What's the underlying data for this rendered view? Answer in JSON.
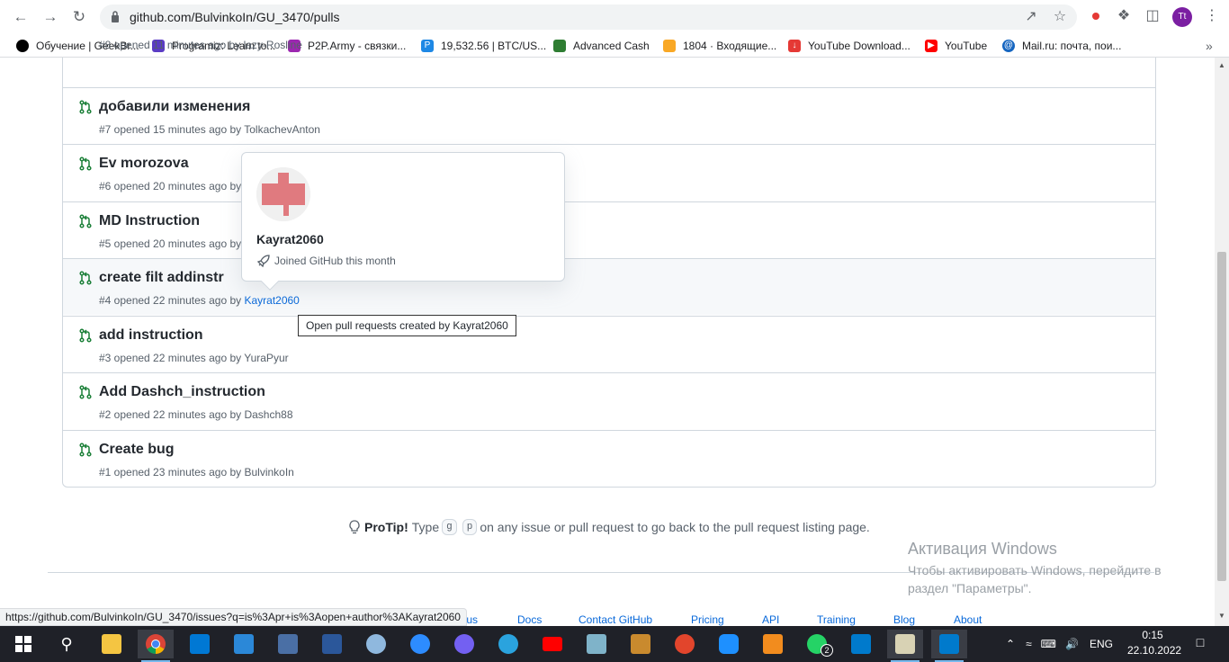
{
  "browser": {
    "url": "github.com/BulvinkoIn/GU_3470/pulls",
    "profile_initials": "Tt",
    "bookmarks": [
      {
        "label": "Обучение | GeekBr...",
        "color": "#000000"
      },
      {
        "label": "Programiz: Learn to...",
        "color": "#5b3cc4"
      },
      {
        "label": "P2P.Army - связки...",
        "color": "#9c27b0"
      },
      {
        "label": "19,532.56 | BTC/US...",
        "color": "#1e88e5"
      },
      {
        "label": "Advanced Cash",
        "color": "#2e7d32"
      },
      {
        "label": "1804 · Входящие...",
        "color": "#f9a825"
      },
      {
        "label": "YouTube Download...",
        "color": "#e53935"
      },
      {
        "label": "YouTube",
        "color": "#ff0000"
      },
      {
        "label": "Mail.ru: почта, пои...",
        "color": "#1565c0"
      }
    ]
  },
  "pulls": [
    {
      "title": "",
      "meta": "#8 opened 11 minutes ago by ",
      "author": "lazy-Rosline"
    },
    {
      "title": "добавили изменения",
      "meta": "#7 opened 15 minutes ago by ",
      "author": "TolkachevAnton"
    },
    {
      "title": "Ev morozova",
      "meta": "#6 opened 20 minutes ago by ",
      "author": ""
    },
    {
      "title": "MD Instruction",
      "meta": "#5 opened 20 minutes ago by ",
      "author": ""
    },
    {
      "title": "create filt addinstr",
      "meta": "#4 opened 22 minutes ago by ",
      "author": "Kayrat2060"
    },
    {
      "title": "add instruction",
      "meta": "#3 opened 22 minutes ago by ",
      "author": "YuraPyur"
    },
    {
      "title": "Add Dashch_instruction",
      "meta": "#2 opened 22 minutes ago by ",
      "author": "Dashch88"
    },
    {
      "title": "Create bug",
      "meta": "#1 opened 23 minutes ago by ",
      "author": "BulvinkoIn"
    }
  ],
  "hovercard": {
    "name": "Kayrat2060",
    "joined": "Joined GitHub this month"
  },
  "tooltip": "Open pull requests created by Kayrat2060",
  "protip": {
    "bold": "ProTip!",
    "before": "Type",
    "key1": "g",
    "key2": "p",
    "after": "on any issue or pull request to go back to the pull request listing page."
  },
  "footer": {
    "links": [
      "tus",
      "Docs",
      "Contact GitHub",
      "Pricing",
      "API",
      "Training",
      "Blog",
      "About"
    ]
  },
  "activation": {
    "title": "Активация Windows",
    "text": "Чтобы активировать Windows, перейдите в раздел \"Параметры\"."
  },
  "status_url": "https://github.com/BulvinkoIn/GU_3470/issues?q=is%3Apr+is%3Aopen+author%3AKayrat2060",
  "taskbar": {
    "lang": "ENG",
    "time": "0:15",
    "date": "22.10.2022",
    "whatsapp_badge": "2"
  },
  "colors": {
    "pr_open_green": "#1a7f37",
    "link_blue": "#0969da",
    "taskbar_bg": "#1f2128"
  }
}
